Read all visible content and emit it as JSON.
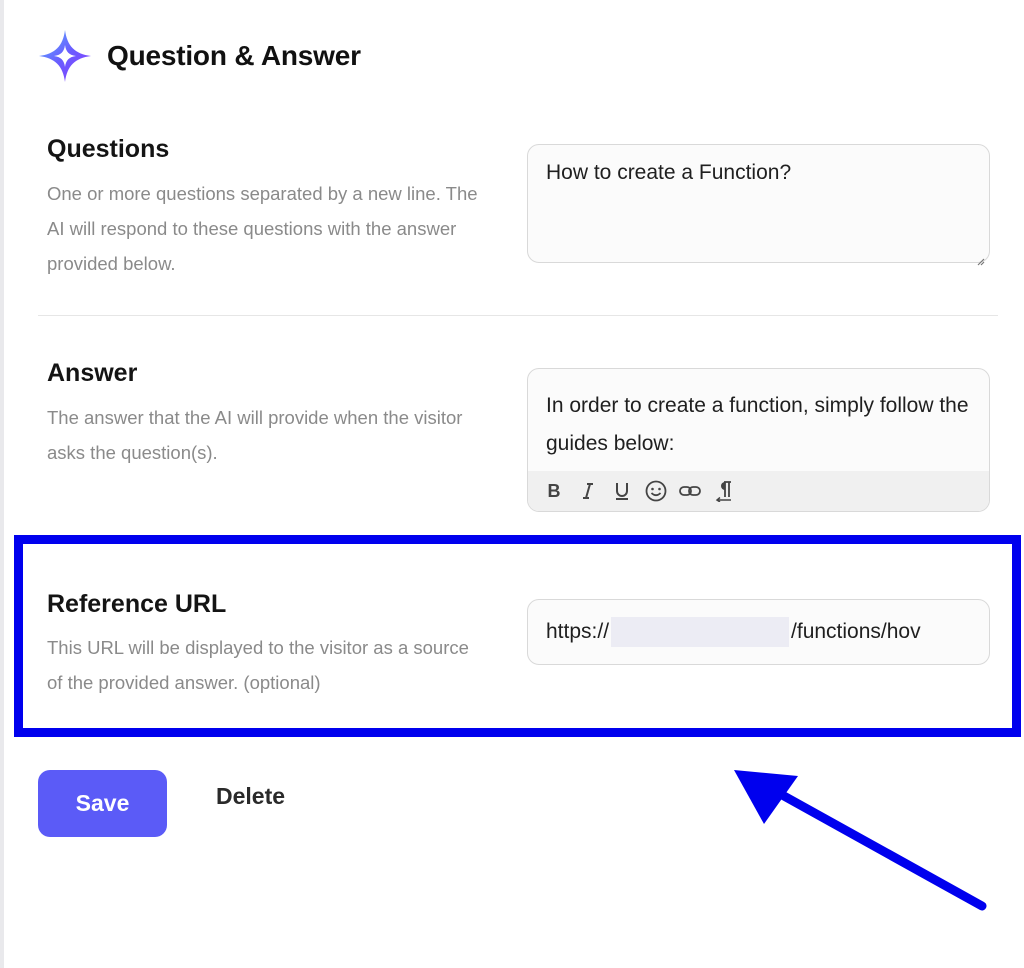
{
  "header": {
    "title": "Question & Answer",
    "logo_icon": "sparkle-icon"
  },
  "questions": {
    "label": "Questions",
    "description": "One or more questions separated by a new line. The AI will respond to these questions with the answer provided below.",
    "value": "How to create a Function?"
  },
  "answer": {
    "label": "Answer",
    "description": "The answer that the AI will provide when the visitor asks the question(s).",
    "value": "In order to create a function, simply follow the guides below:",
    "toolbar": [
      "bold-icon",
      "italic-icon",
      "underline-icon",
      "emoji-icon",
      "link-icon",
      "paragraph-icon"
    ]
  },
  "reference_url": {
    "label": "Reference URL",
    "description": "This URL will be displayed to the visitor as a source of the provided answer. (optional)",
    "value_prefix": "https://",
    "value_suffix": "/functions/hov"
  },
  "actions": {
    "save_label": "Save",
    "delete_label": "Delete"
  },
  "colors": {
    "accent": "#5b5bf7",
    "annotation": "#0000ee"
  }
}
